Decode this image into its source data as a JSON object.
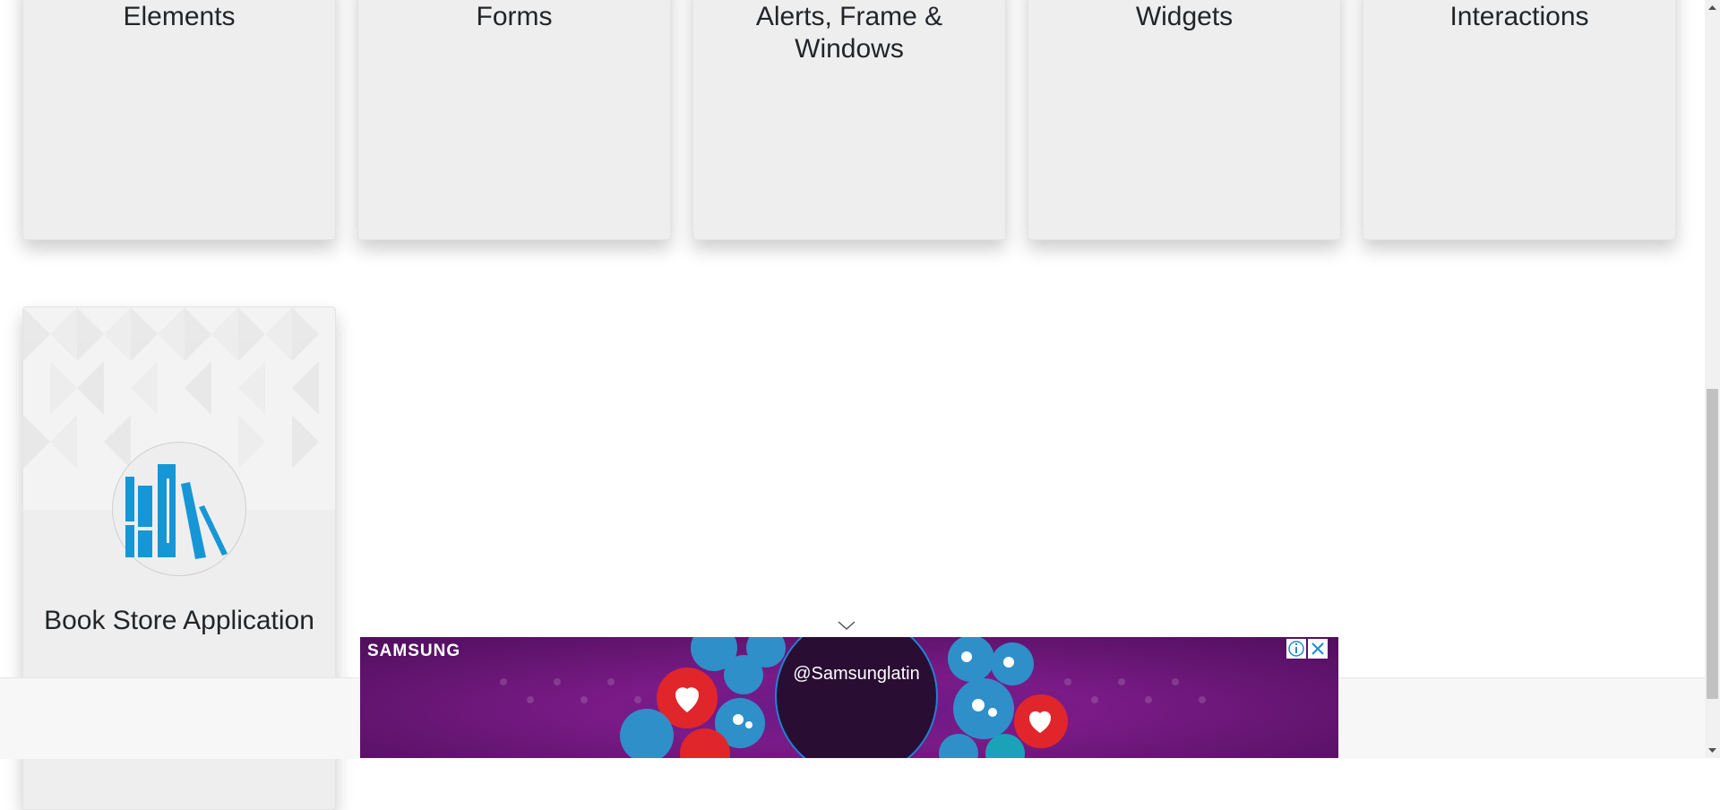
{
  "cards": [
    {
      "title": "Elements"
    },
    {
      "title": "Forms"
    },
    {
      "title": "Alerts, Frame & Windows"
    },
    {
      "title": "Widgets"
    },
    {
      "title": "Interactions"
    }
  ],
  "book_store": {
    "title": "Book Store Application",
    "icon": "book-store-icon"
  },
  "ad": {
    "brand": "SAMSUNG",
    "handle": "@Samsunglatin",
    "info_icon": "info-icon",
    "close_icon": "close-icon",
    "toggle_icon": "chevron-down-icon"
  },
  "colors": {
    "card_bg": "#eeeeee",
    "text": "#212529",
    "icon_blue": "#1796d5",
    "ad_purple": "#6a1a8a"
  }
}
